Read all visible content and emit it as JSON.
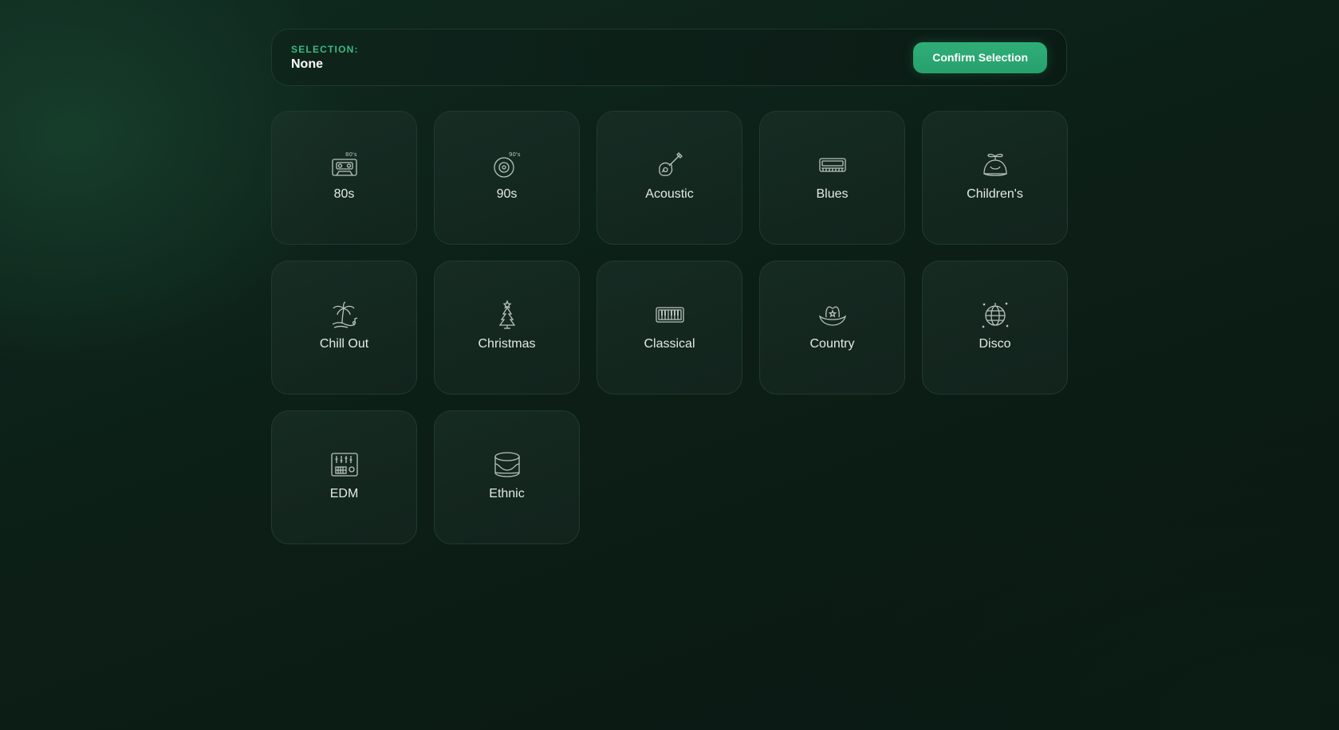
{
  "header": {
    "selection_label": "SELECTION:",
    "selection_value": "None",
    "confirm_label": "Confirm Selection"
  },
  "genres": [
    {
      "label": "80s",
      "icon": "cassette-80s-icon",
      "icon_text": "80's"
    },
    {
      "label": "90s",
      "icon": "cd-90s-icon",
      "icon_text": "90's"
    },
    {
      "label": "Acoustic",
      "icon": "guitar-icon"
    },
    {
      "label": "Blues",
      "icon": "harmonica-icon"
    },
    {
      "label": "Children's",
      "icon": "propeller-hat-icon"
    },
    {
      "label": "Chill Out",
      "icon": "palm-tree-icon"
    },
    {
      "label": "Christmas",
      "icon": "christmas-tree-icon"
    },
    {
      "label": "Classical",
      "icon": "piano-keys-icon"
    },
    {
      "label": "Country",
      "icon": "cowboy-hat-icon"
    },
    {
      "label": "Disco",
      "icon": "disco-ball-icon"
    },
    {
      "label": "EDM",
      "icon": "mixer-icon"
    },
    {
      "label": "Ethnic",
      "icon": "drum-icon"
    }
  ],
  "colors": {
    "accent": "#2fae78",
    "accent_text": "#3fb883",
    "icon_stroke": "#b9c3bd"
  }
}
